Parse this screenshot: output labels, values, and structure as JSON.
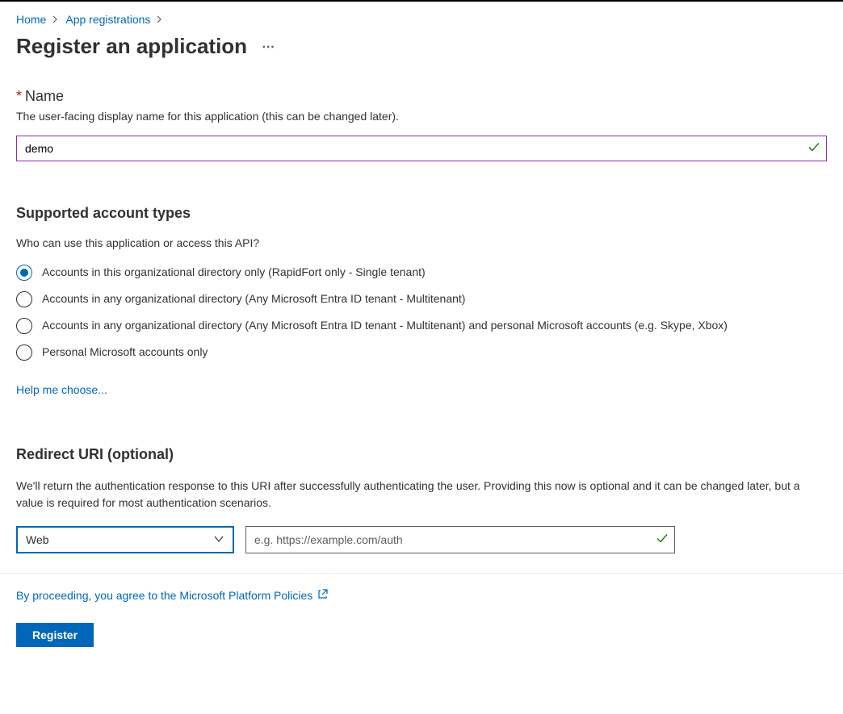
{
  "breadcrumb": {
    "home": "Home",
    "app_registrations": "App registrations"
  },
  "page_title": "Register an application",
  "name_section": {
    "label": "Name",
    "description": "The user-facing display name for this application (this can be changed later).",
    "value": "demo"
  },
  "account_types_section": {
    "heading": "Supported account types",
    "question": "Who can use this application or access this API?",
    "options": [
      "Accounts in this organizational directory only (RapidFort only - Single tenant)",
      "Accounts in any organizational directory (Any Microsoft Entra ID tenant - Multitenant)",
      "Accounts in any organizational directory (Any Microsoft Entra ID tenant - Multitenant) and personal Microsoft accounts (e.g. Skype, Xbox)",
      "Personal Microsoft accounts only"
    ],
    "help_link": "Help me choose..."
  },
  "redirect_section": {
    "heading": "Redirect URI (optional)",
    "description": "We'll return the authentication response to this URI after successfully authenticating the user. Providing this now is optional and it can be changed later, but a value is required for most authentication scenarios.",
    "platform_value": "Web",
    "uri_placeholder": "e.g. https://example.com/auth"
  },
  "footer": {
    "policy_text": "By proceeding, you agree to the Microsoft Platform Policies",
    "register_button": "Register"
  }
}
